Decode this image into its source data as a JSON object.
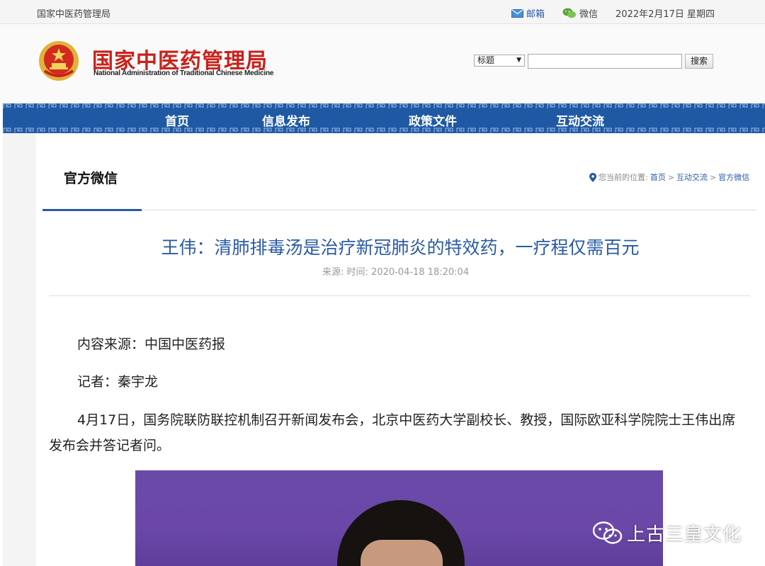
{
  "topbar": {
    "site_name": "国家中医药管理局",
    "mail_label": "邮箱",
    "wechat_label": "微信",
    "date": "2022年2月17日 星期四"
  },
  "header": {
    "brand_cn": "国家中医药管理局",
    "brand_en": "National Administration of Traditional Chinese Medicine",
    "search": {
      "select_value": "标题",
      "input_value": "",
      "button_label": "搜索"
    }
  },
  "nav": {
    "items": [
      {
        "label": "首页"
      },
      {
        "label": "信息发布"
      },
      {
        "label": "政策文件"
      },
      {
        "label": "互动交流"
      }
    ]
  },
  "section": {
    "title": "官方微信",
    "breadcrumb_prefix": "您当前的位置:",
    "breadcrumb": [
      "首页",
      "互动交流",
      "官方微信"
    ],
    "breadcrumb_sep": ">"
  },
  "article": {
    "title": "王伟：清肺排毒汤是治疗新冠肺炎的特效药，一疗程仅需百元",
    "meta": "来源:  时间:  2020-04-18 18:20:04",
    "paragraphs": [
      "内容来源：中国中医药报",
      "记者：秦宇龙",
      "4月17日，国务院联防联控机制召开新闻发布会，北京中医药大学副校长、教授，国际欧亚科学院院士王伟出席发布会并答记者问。"
    ]
  },
  "watermark": {
    "text": "上古三皇文化"
  },
  "colors": {
    "brand_red": "#c8221b",
    "nav_blue": "#1f59a4",
    "link_blue": "#2a5aa5"
  },
  "icons": {
    "mail": "mail-icon",
    "wechat": "wechat-icon",
    "location": "location-pin-icon",
    "emblem": "national-emblem-icon"
  }
}
